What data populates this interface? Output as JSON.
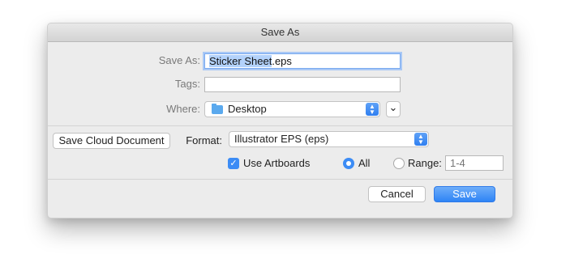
{
  "dialog": {
    "title": "Save As",
    "save_as_label": "Save As:",
    "filename_selected": "Sticker Sheet",
    "filename_ext": ".eps",
    "tags_label": "Tags:",
    "tags_value": "",
    "where_label": "Where:",
    "where_value": "Desktop",
    "expand_glyph": "⌄",
    "stepper_glyph_up": "▲",
    "stepper_glyph_down": "▼",
    "cloud_button": "Save Cloud Document",
    "format_label": "Format:",
    "format_value": "Illustrator EPS (eps)",
    "use_artboards_label": "Use Artboards",
    "use_artboards_checked": true,
    "check_glyph": "✓",
    "all_label": "All",
    "all_selected": true,
    "range_label": "Range:",
    "range_placeholder": "1-4",
    "cancel_button": "Cancel",
    "save_button": "Save"
  },
  "colors": {
    "accent": "#3c8cf5",
    "selection": "#b3d2fb"
  }
}
